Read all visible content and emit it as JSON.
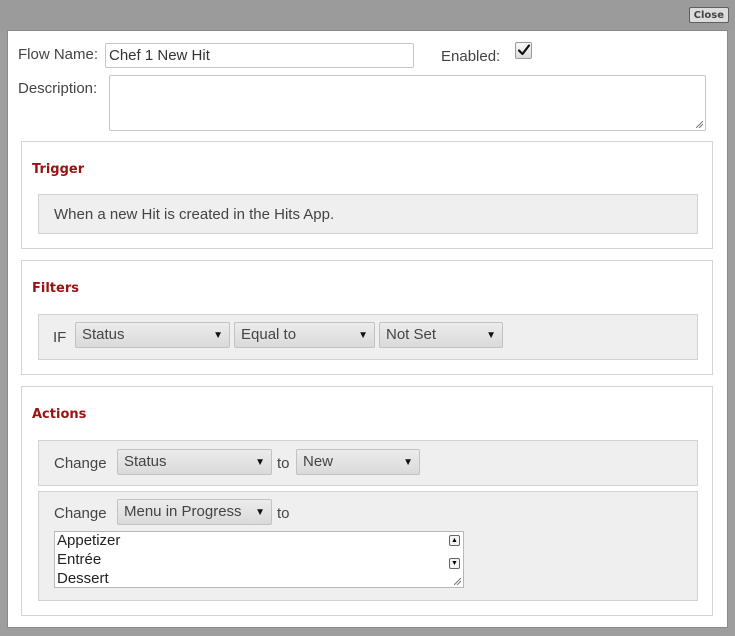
{
  "titlebar": {
    "close_label": "Close"
  },
  "form": {
    "flow_name_label": "Flow Name:",
    "flow_name_value": "Chef 1 New Hit",
    "enabled_label": "Enabled:",
    "enabled_checked": true,
    "description_label": "Description:",
    "description_value": ""
  },
  "trigger": {
    "title": "Trigger",
    "text": "When a new Hit is created in the Hits App."
  },
  "filters": {
    "title": "Filters",
    "if_label": "IF",
    "field_select": "Status",
    "operator_select": "Equal to",
    "value_select": "Not Set"
  },
  "actions": {
    "title": "Actions",
    "action1": {
      "change_label": "Change",
      "field_select": "Status",
      "to_label": "to",
      "value_select": "New"
    },
    "action2": {
      "change_label": "Change",
      "field_select": "Menu in Progress",
      "to_label": "to",
      "list_items": [
        "Appetizer",
        "Entrée",
        "Dessert"
      ]
    }
  },
  "icons": {
    "checkmark": "check-icon",
    "dropdown": "triangle-down-icon",
    "resize": "resize-grip-icon"
  }
}
